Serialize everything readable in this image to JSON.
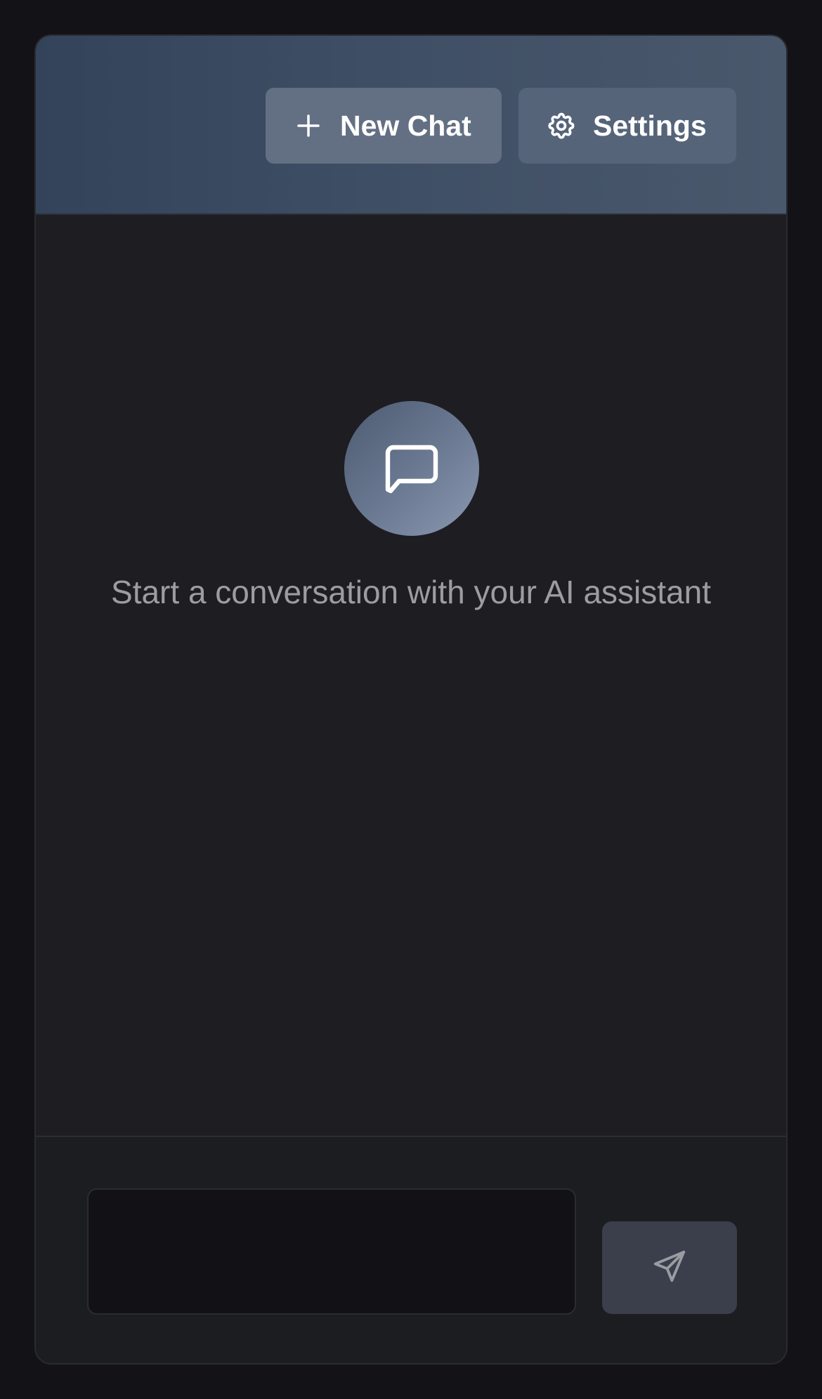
{
  "header": {
    "new_chat_label": "New Chat",
    "new_chat_icon": "plus-icon",
    "settings_label": "Settings",
    "settings_icon": "gear-icon"
  },
  "empty_state": {
    "icon": "chat-bubble-icon",
    "message": "Start a conversation with your AI assistant"
  },
  "composer": {
    "input_value": "",
    "input_placeholder": "",
    "send_icon": "send-icon"
  },
  "colors": {
    "background": "#121217",
    "panel": "#1e1d22",
    "header_start": "#33435a",
    "header_end": "#4a586c",
    "new_chat_button": "#637083",
    "settings_button": "#56647a",
    "send_button": "#3a3f4b"
  }
}
